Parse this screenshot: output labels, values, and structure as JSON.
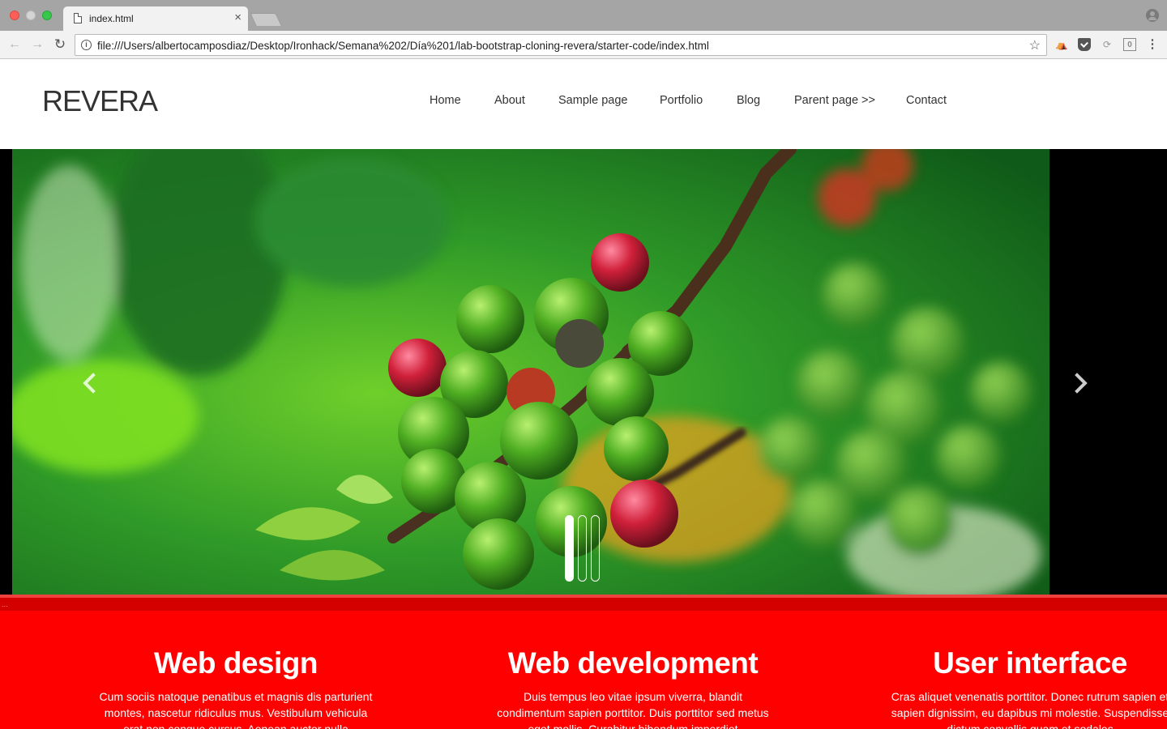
{
  "browser": {
    "tab_title": "index.html",
    "tab_close": "×",
    "url": "file:///Users/albertocamposdiaz/Desktop/Ironhack/Semana%202/Día%201/lab-bootstrap-cloning-revera/starter-code/index.html",
    "back_glyph": "←",
    "forward_glyph": "→",
    "reload_glyph": "↻",
    "star_glyph": "☆",
    "info_glyph": "i",
    "menu_glyph": "⋮",
    "ext_labels": [
      "⛺",
      "",
      "⟳",
      "0"
    ]
  },
  "site": {
    "brand": "REVERA",
    "nav": [
      {
        "label": "Home"
      },
      {
        "label": "About"
      },
      {
        "label": "Sample page"
      },
      {
        "label": "Portfolio"
      },
      {
        "label": "Blog"
      },
      {
        "label": "Parent page >>"
      },
      {
        "label": "Contact"
      }
    ]
  },
  "carousel": {
    "slide_count": 3,
    "active_index": 0,
    "image_subject": "coffee-berries-photo"
  },
  "divider": {
    "dots": "..."
  },
  "features": [
    {
      "title": "Web design",
      "text": "Cum sociis natoque penatibus et magnis dis parturient montes, nascetur ridiculus mus. Vestibulum vehicula erat non congue cursus. Aenean auctor nulla"
    },
    {
      "title": "Web development",
      "text": "Duis tempus leo vitae ipsum viverra, blandit condimentum sapien porttitor. Duis porttitor sed metus eget mollis. Curabitur bibendum imperdiet"
    },
    {
      "title": "User interface",
      "text": "Cras aliquet venenatis porttitor. Donec rutrum sapien et sapien dignissim, eu dapibus mi molestie. Suspendisse dictum convallis quam et sodales"
    }
  ],
  "colors": {
    "features_bg": "#ff0000",
    "divider": "#d40000",
    "carousel_bg": "#000000",
    "brand_text": "#333333"
  }
}
